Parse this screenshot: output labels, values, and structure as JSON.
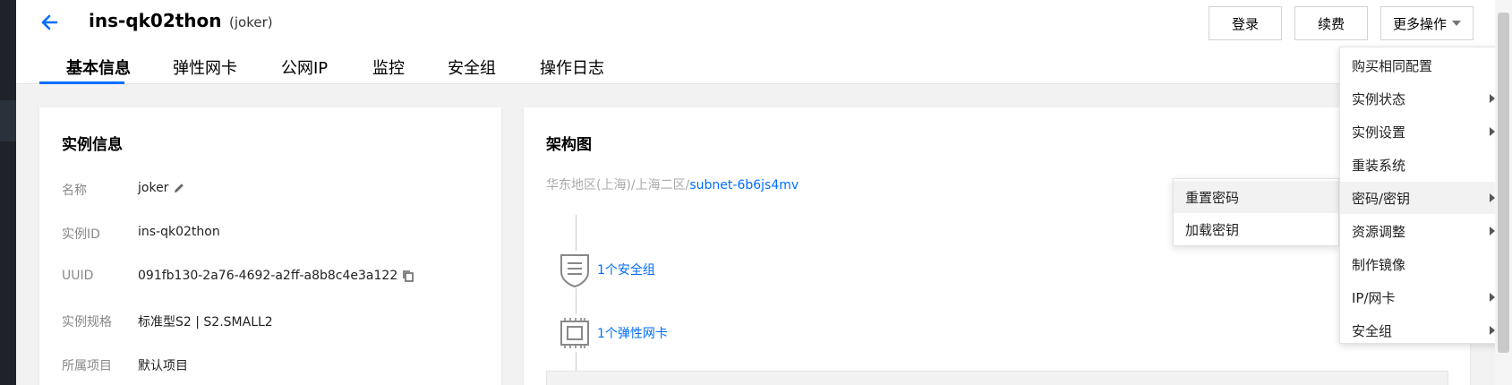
{
  "header": {
    "title": "ins-qk02thon",
    "subtitle": "(joker)",
    "buttons": {
      "login": "登录",
      "renew": "续费",
      "more": "更多操作"
    }
  },
  "tabs": [
    {
      "label": "基本信息",
      "active": true
    },
    {
      "label": "弹性网卡"
    },
    {
      "label": "公网IP"
    },
    {
      "label": "监控"
    },
    {
      "label": "安全组"
    },
    {
      "label": "操作日志"
    }
  ],
  "instance_info": {
    "title": "实例信息",
    "rows": [
      {
        "label": "名称",
        "value": "joker"
      },
      {
        "label": "实例ID",
        "value": "ins-qk02thon"
      },
      {
        "label": "UUID",
        "value": "091fb130-2a76-4692-a2ff-a8b8c4e3a122"
      },
      {
        "label": "实例规格",
        "value": "标准型S2 | S2.SMALL2"
      },
      {
        "label": "所属项目",
        "value": "默认项目"
      }
    ]
  },
  "architecture": {
    "title": "架构图",
    "breadcrumb_prefix": "华东地区(上海)/上海二区/",
    "subnet": "subnet-6b6js4mv",
    "nodes": [
      {
        "icon": "shield-icon",
        "label": "1个安全组"
      },
      {
        "icon": "network-card-icon",
        "label": "1个弹性网卡"
      }
    ]
  },
  "more_menu": {
    "items": [
      {
        "label": "购买相同配置",
        "submenu": false
      },
      {
        "label": "实例状态",
        "submenu": true
      },
      {
        "label": "实例设置",
        "submenu": true
      },
      {
        "label": "重装系统",
        "submenu": false
      },
      {
        "label": "密码/密钥",
        "submenu": true,
        "highlighted": true
      },
      {
        "label": "资源调整",
        "submenu": true
      },
      {
        "label": "制作镜像",
        "submenu": false
      },
      {
        "label": "IP/网卡",
        "submenu": true
      },
      {
        "label": "安全组",
        "submenu": true
      }
    ],
    "password_submenu": [
      {
        "label": "重置密码",
        "highlighted": true
      },
      {
        "label": "加载密钥"
      }
    ]
  },
  "colors": {
    "accent": "#006eff",
    "highlight": "#f2f2f2"
  }
}
